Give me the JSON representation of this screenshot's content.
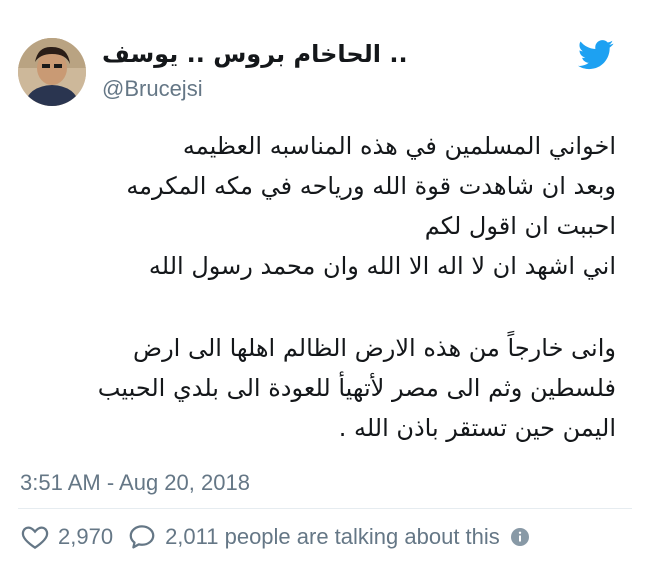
{
  "tweet": {
    "display_name": ".. الحاخام بروس .. يوسف",
    "handle": "@Brucejsi",
    "body_lines": [
      "اخواني المسلمين في هذه المناسبه العظيمه",
      "وبعد ان شاهدت قوة الله ورياحه في مكه المكرمه",
      "احببت ان اقول لكم",
      "اني اشهد ان لا اله الا الله وان محمد رسول الله",
      "وانى خارجاً من هذه الارض الظالم اهلها الى ارض",
      "فلسطين وثم الى مصر لأتهيأ للعودة الى بلدي الحبيب",
      "اليمن حين تستقر باذن الله ."
    ],
    "timestamp": "3:51 AM - Aug 20, 2018",
    "likes": "2,970",
    "talking": "2,011 people are talking about this"
  },
  "icons": {
    "brand": "twitter-bird-icon",
    "like": "heart-icon",
    "reply": "speech-bubble-icon",
    "info": "info-icon"
  },
  "colors": {
    "brand": "#1da1f2",
    "muted": "#657786",
    "text": "#14171a"
  }
}
